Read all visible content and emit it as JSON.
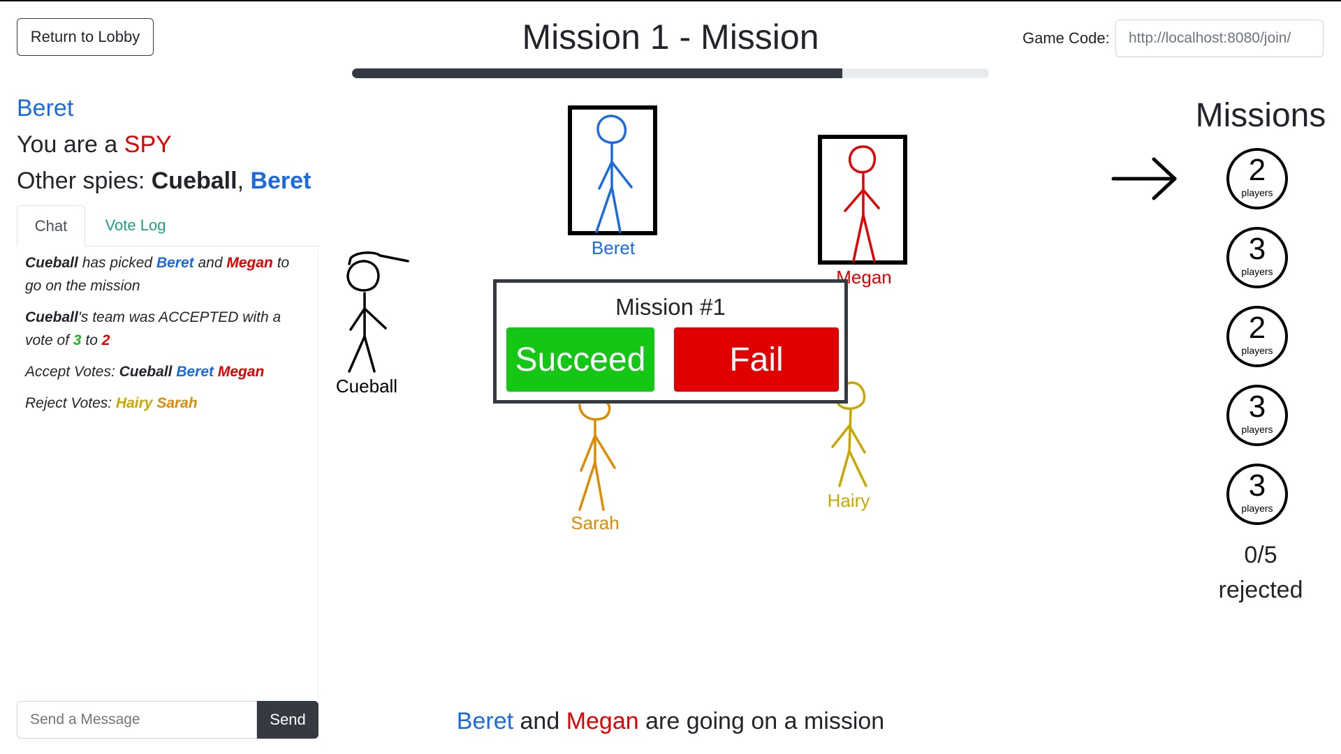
{
  "header": {
    "return_label": "Return to Lobby",
    "title": "Mission 1 - Mission",
    "progress_fraction": 0.77,
    "game_code_label": "Game Code:",
    "game_code_value": "http://localhost:8080/join/"
  },
  "player": {
    "name": "Beret",
    "role_prefix": "You are a ",
    "role": "SPY",
    "spies_prefix": "Other spies: ",
    "spies": [
      "Cueball",
      "Beret"
    ],
    "spies_sep": ", "
  },
  "tabs": {
    "chat": "Chat",
    "vote_log": "Vote Log"
  },
  "chat": {
    "m1": {
      "who": "Cueball",
      "t1": " has picked ",
      "p1": "Beret",
      "t2": " and ",
      "p2": "Megan",
      "t3": " to go on the mission"
    },
    "m2": {
      "who": "Cueball",
      "t1": "'s team was ACCEPTED with a vote of ",
      "yes": "3",
      "t2": " to ",
      "no": "2"
    },
    "m3": {
      "label": "Accept Votes: ",
      "v1": "Cueball",
      "v2": "Beret",
      "v3": "Megan"
    },
    "m4": {
      "label": "Reject Votes: ",
      "v1": "Hairy",
      "v2": "Sarah"
    },
    "input_placeholder": "Send a Message",
    "send_label": "Send"
  },
  "board": {
    "players": {
      "beret": "Beret",
      "megan": "Megan",
      "cueball": "Cueball",
      "sarah": "Sarah",
      "hairy": "Hairy"
    },
    "modal_title": "Mission #1",
    "succeed_label": "Succeed",
    "fail_label": "Fail",
    "status": {
      "p1": "Beret",
      "and": " and ",
      "p2": "Megan",
      "rest": " are going on a mission"
    }
  },
  "missions": {
    "title": "Missions",
    "unit": "players",
    "counts": [
      "2",
      "3",
      "2",
      "3",
      "3"
    ],
    "rejected_count": "0/5",
    "rejected_label": "rejected"
  },
  "colors": {
    "beret": "#1a6be0",
    "megan": "#e00000",
    "cueball": "#000000",
    "sarah": "#e08a00",
    "hairy": "#c8a800",
    "spy": "#e00000"
  }
}
